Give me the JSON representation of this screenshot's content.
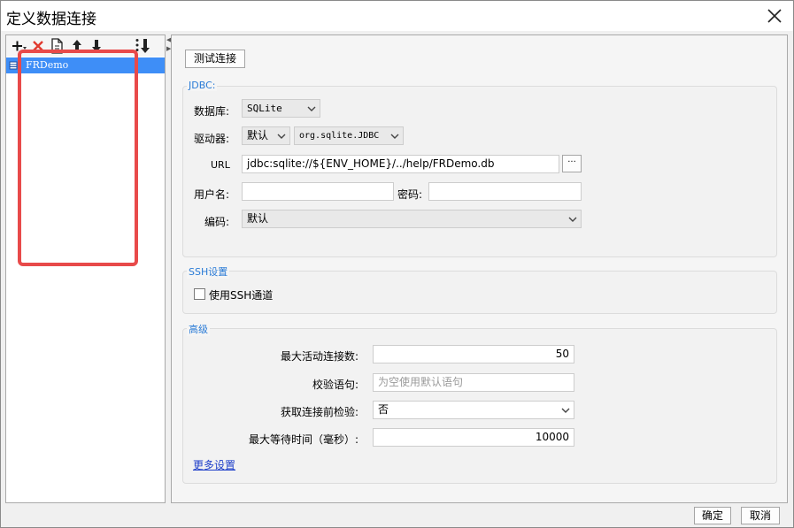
{
  "window": {
    "title": "定义数据连接"
  },
  "tree": {
    "items": [
      {
        "label": "FRDemo"
      }
    ]
  },
  "right": {
    "test_button": "测试连接",
    "jdbc": {
      "title": "JDBC:",
      "database_label": "数据库:",
      "database_value": "SQLite",
      "driver_label": "驱动器:",
      "driver_mode": "默认",
      "driver_class": "org.sqlite.JDBC",
      "url_label": "URL",
      "url_value": "jdbc:sqlite://${ENV_HOME}/../help/FRDemo.db",
      "url_browse": "···",
      "username_label": "用户名:",
      "username_value": "",
      "password_label": "密码:",
      "password_value": "",
      "encoding_label": "编码:",
      "encoding_value": "默认"
    },
    "ssh": {
      "title": "SSH设置",
      "use_tunnel_label": "使用SSH通道"
    },
    "advanced": {
      "title": "高级",
      "max_active_label": "最大活动连接数:",
      "max_active_value": "50",
      "validation_label": "校验语句:",
      "validation_placeholder": "为空使用默认语句",
      "test_before_label": "获取连接前检验:",
      "test_before_value": "否",
      "max_wait_label": "最大等待时间（毫秒）:",
      "max_wait_value": "10000",
      "more_settings": "更多设置"
    }
  },
  "footer": {
    "ok": "确定",
    "cancel": "取消"
  }
}
